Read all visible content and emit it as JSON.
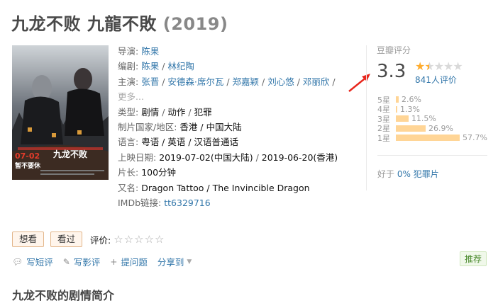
{
  "title": {
    "name": "九龙不败 九龍不敗",
    "year": "(2019)"
  },
  "poster": {
    "date_text": "07-02",
    "tagline_text": "暂不要休",
    "title_text": "九龙不败"
  },
  "info": {
    "director_label": "导演:",
    "director": "陈果",
    "writer_label": "编剧:",
    "writers": [
      "陈果",
      "林纪陶"
    ],
    "cast_label": "主演:",
    "cast": [
      "张晋",
      "安德森·席尔瓦",
      "郑嘉颖",
      "刘心悠",
      "邓丽欣"
    ],
    "cast_more": "更多...",
    "genre_label": "类型:",
    "genres": [
      "剧情",
      "动作",
      "犯罪"
    ],
    "country_label": "制片国家/地区:",
    "country": "香港 / 中国大陆",
    "language_label": "语言:",
    "language": "粤语 / 英语 / 汉语普通话",
    "release_label": "上映日期:",
    "release_1": "2019-07-02(中国大陆)",
    "release_2": "2019-06-20(香港)",
    "runtime_label": "片长:",
    "runtime": "100分钟",
    "aka_label": "又名:",
    "aka": "Dragon Tattoo / The Invincible Dragon",
    "imdb_label": "IMDb链接:",
    "imdb": "tt6329716"
  },
  "rating": {
    "label": "豆瓣评分",
    "score": "3.3",
    "star_level": 1.5,
    "count_text": "841人评价",
    "distribution": [
      {
        "label": "5星",
        "pct": "2.6%",
        "value": 2.6
      },
      {
        "label": "4星",
        "pct": "1.3%",
        "value": 1.3
      },
      {
        "label": "3星",
        "pct": "11.5%",
        "value": 11.5
      },
      {
        "label": "2星",
        "pct": "26.9%",
        "value": 26.9
      },
      {
        "label": "1星",
        "pct": "57.7%",
        "value": 57.7
      }
    ],
    "better_prefix": "好于",
    "better_pct": "0% 犯罪片"
  },
  "actions": {
    "want_label": "想看",
    "seen_label": "看过",
    "rate_label": "评价:"
  },
  "links": {
    "short_review": "写短评",
    "review": "写影评",
    "question": "提问题",
    "share": "分享到"
  },
  "recommend_label": "推荐",
  "bottom_heading": "九龙不败的剧情简介",
  "colors": {
    "link": "#3377aa",
    "star": "#ffac2d",
    "bar": "#ffd596",
    "arrow": "#e8261c"
  }
}
